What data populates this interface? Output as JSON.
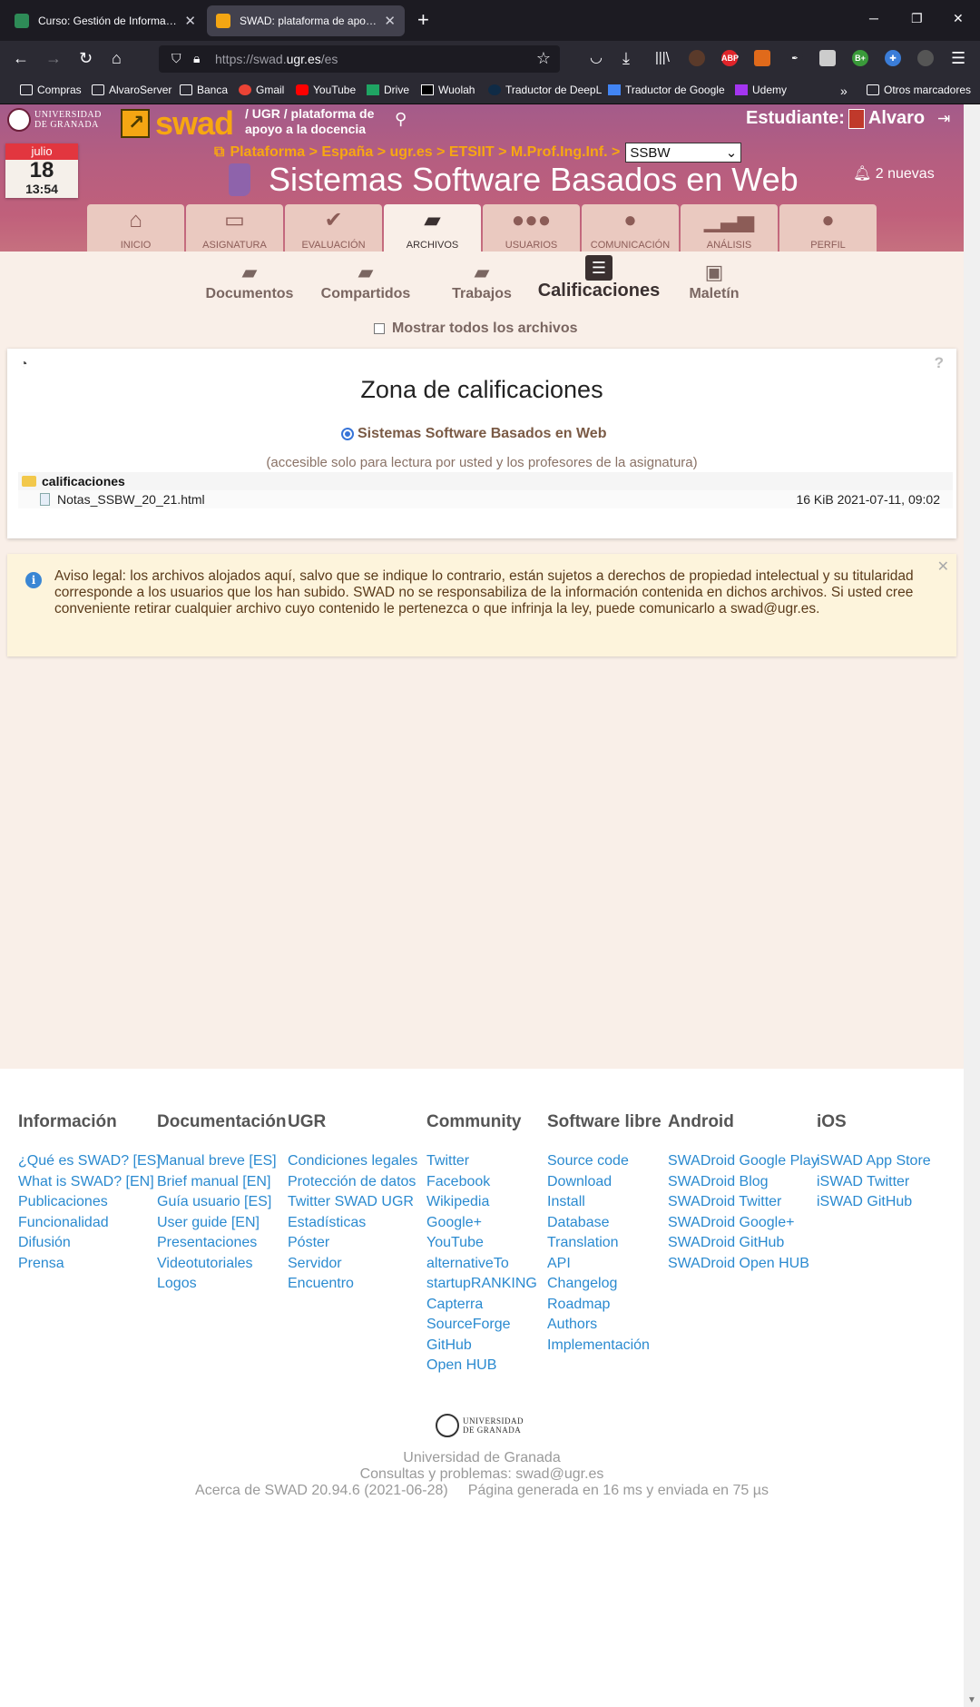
{
  "browser": {
    "tabs": [
      {
        "title": "Curso: Gestión de Información en la Web"
      },
      {
        "title": "SWAD: plataforma de apoyo a la docencia"
      }
    ],
    "new_tab_icon": "+",
    "url_scheme": "https://swad.",
    "url_domain": "ugr.es",
    "url_path": "/es",
    "bookmarks": [
      {
        "label": "Compras",
        "icon": "folder-icon"
      },
      {
        "label": "AlvaroServer",
        "icon": "folder-icon"
      },
      {
        "label": "Banca",
        "icon": "folder-icon"
      },
      {
        "label": "Gmail",
        "icon": "google-icon"
      },
      {
        "label": "YouTube",
        "icon": "youtube-icon"
      },
      {
        "label": "Drive",
        "icon": "drive-icon"
      },
      {
        "label": "Wuolah",
        "icon": "wuolah-icon"
      },
      {
        "label": "Traductor de DeepL",
        "icon": "deepl-icon"
      },
      {
        "label": "Traductor de Google",
        "icon": "google-translate-icon"
      },
      {
        "label": "Udemy",
        "icon": "udemy-icon"
      }
    ],
    "other_bookmarks": "Otros marcadores",
    "extensions": [
      "ABP",
      "B+"
    ]
  },
  "header": {
    "university_line1": "UNIVERSIDAD",
    "university_line2": "DE GRANADA",
    "logo_text": "swad",
    "tagline_line1": "/ UGR / plataforma de",
    "tagline_line2": "apoyo a la docencia",
    "student_label": "Estudiante:",
    "student_name": "Alvaro",
    "calendar": {
      "month": "julio",
      "day": "18",
      "time": "13:54"
    },
    "breadcrumb": "Plataforma > España > ugr.es > ETSIIT > M.Prof.Ing.Inf. >",
    "course_select": "SSBW",
    "course_title": "Sistemas Software Basados en Web",
    "notifications": "2 nuevas"
  },
  "main_tabs": [
    {
      "label": "INICIO",
      "icon": "home-icon"
    },
    {
      "label": "ASIGNATURA",
      "icon": "presentation-icon"
    },
    {
      "label": "EVALUACIÓN",
      "icon": "check-icon"
    },
    {
      "label": "ARCHIVOS",
      "icon": "folder-open-icon",
      "active": true
    },
    {
      "label": "USUARIOS",
      "icon": "users-icon"
    },
    {
      "label": "COMUNICACIÓN",
      "icon": "chat-icon"
    },
    {
      "label": "ANÁLISIS",
      "icon": "bar-chart-icon"
    },
    {
      "label": "PERFIL",
      "icon": "user-icon"
    }
  ],
  "sub_tabs": [
    {
      "label": "Documentos"
    },
    {
      "label": "Compartidos"
    },
    {
      "label": "Trabajos"
    },
    {
      "label": "Calificaciones",
      "active": true
    },
    {
      "label": "Maletín"
    }
  ],
  "show_all_files": "Mostrar todos los archivos",
  "grades": {
    "title": "Zona de calificaciones",
    "course_radio": "Sistemas Software Basados en Web",
    "access_note": "(accesible solo para lectura por usted y los profesores de la asignatura)",
    "folder": "calificaciones",
    "file": {
      "name": "Notas_SSBW_20_21.html",
      "meta": "16 KiB 2021-07-11, 09:02"
    }
  },
  "notice": {
    "text": "Aviso legal: los archivos alojados aquí, salvo que se indique lo contrario, están sujetos a derechos de propiedad intelectual y su titularidad corresponde a los usuarios que los han subido. SWAD no se responsabiliza de la información contenida en dichos archivos. Si usted cree conveniente retirar cualquier archivo cuyo contenido le pertenezca o que infrinja la ley, puede comunicarlo a swad@ugr.es."
  },
  "footer": {
    "columns": [
      {
        "title": "Información",
        "links": [
          "¿Qué es SWAD? [ES]",
          "What is SWAD? [EN]",
          "Publicaciones",
          "Funcionalidad",
          "Difusión",
          "Prensa"
        ]
      },
      {
        "title": "Documentación",
        "links": [
          "Manual breve [ES]",
          "Brief manual [EN]",
          "Guía usuario [ES]",
          "User guide [EN]",
          "Presentaciones",
          "Videotutoriales",
          "Logos"
        ]
      },
      {
        "title": "UGR",
        "links": [
          "Condiciones legales",
          "Protección de datos",
          "Twitter SWAD UGR",
          "Estadísticas",
          "Póster",
          "Servidor",
          "Encuentro"
        ]
      },
      {
        "title": "Community",
        "links": [
          "Twitter",
          "Facebook",
          "Wikipedia",
          "Google+",
          "YouTube",
          "alternativeTo",
          "startupRANKING",
          "Capterra",
          "SourceForge",
          "GitHub",
          "Open HUB"
        ]
      },
      {
        "title": "Software libre",
        "links": [
          "Source code",
          "Download",
          "Install",
          "Database",
          "Translation",
          "API",
          "Changelog",
          "Roadmap",
          "Authors",
          "Implementación"
        ]
      },
      {
        "title": "Android",
        "links": [
          "SWADroid Google Play",
          "SWADroid Blog",
          "SWADroid Twitter",
          "SWADroid Google+",
          "SWADroid GitHub",
          "SWADroid Open HUB"
        ]
      },
      {
        "title": "iOS",
        "links": [
          "iSWAD App Store",
          "iSWAD Twitter",
          "iSWAD GitHub"
        ]
      }
    ],
    "university": "Universidad de Granada",
    "contact": "Consultas y problemas: swad@ugr.es",
    "version": "Acerca de SWAD 20.94.6 (2021-06-28)",
    "timing": "Página generada en 16 ms y enviada en 75 µs"
  }
}
